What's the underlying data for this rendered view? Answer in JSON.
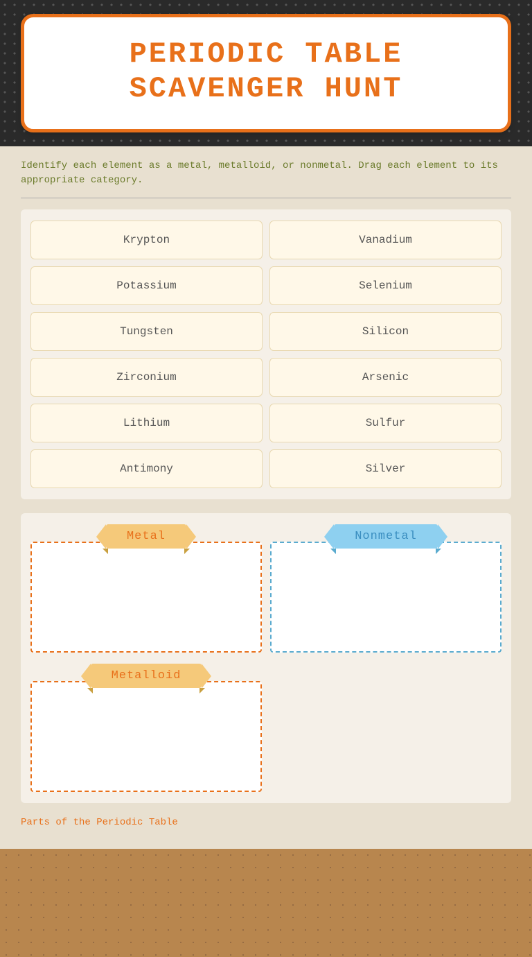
{
  "page": {
    "title_line1": "PERIODIC TABLE",
    "title_line2": "SCAVENGER HUNT",
    "instruction": "Identify each element as a metal, metalloid, or nonmetal. Drag each element to its appropriate category.",
    "footer": "Parts of the Periodic Table"
  },
  "elements": [
    {
      "name": "Krypton",
      "col": 0
    },
    {
      "name": "Vanadium",
      "col": 1
    },
    {
      "name": "Potassium",
      "col": 0
    },
    {
      "name": "Selenium",
      "col": 1
    },
    {
      "name": "Tungsten",
      "col": 0
    },
    {
      "name": "Silicon",
      "col": 1
    },
    {
      "name": "Zirconium",
      "col": 0
    },
    {
      "name": "Arsenic",
      "col": 1
    },
    {
      "name": "Lithium",
      "col": 0
    },
    {
      "name": "Sulfur",
      "col": 1
    },
    {
      "name": "Antimony",
      "col": 0
    },
    {
      "name": "Silver",
      "col": 1
    }
  ],
  "categories": {
    "metal": {
      "label": "Metal",
      "color": "orange"
    },
    "nonmetal": {
      "label": "Nonmetal",
      "color": "blue"
    },
    "metalloid": {
      "label": "Metalloid",
      "color": "orange"
    }
  }
}
